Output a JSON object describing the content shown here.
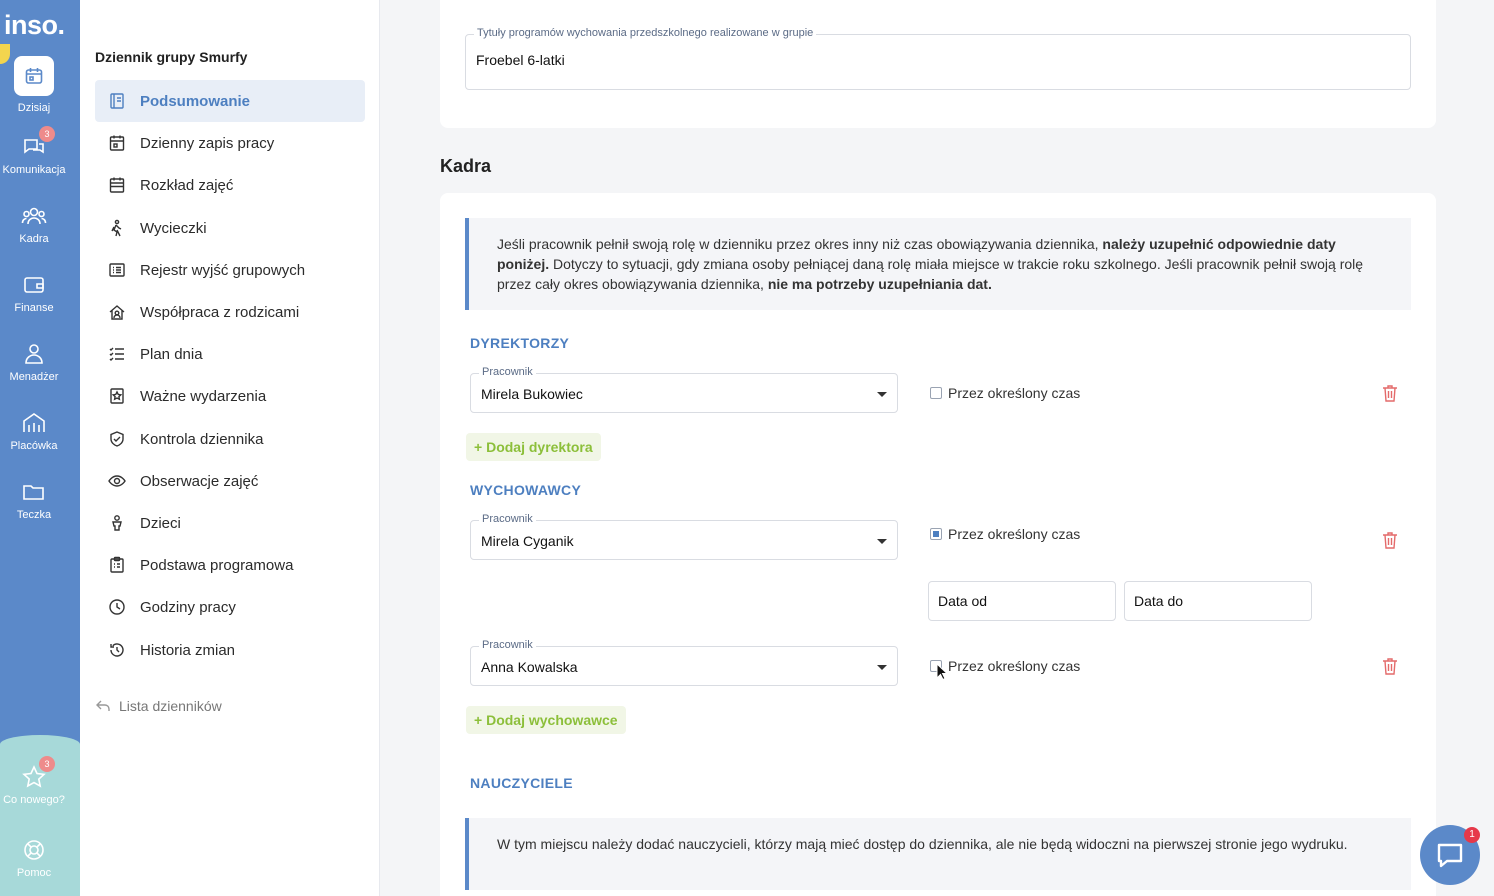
{
  "rail": {
    "logo": "inso.",
    "items": [
      {
        "label": "Dzisiaj",
        "icon": "calendar-icon"
      },
      {
        "label": "Komunikacja",
        "icon": "chat-icon",
        "badge": "3"
      },
      {
        "label": "Kadra",
        "icon": "people-icon"
      },
      {
        "label": "Finanse",
        "icon": "wallet-icon"
      },
      {
        "label": "Menadżer",
        "icon": "manager-icon"
      },
      {
        "label": "Placówka",
        "icon": "building-icon"
      },
      {
        "label": "Teczka",
        "icon": "folder-icon"
      },
      {
        "label": "Co nowego?",
        "icon": "star-icon",
        "badge": "3"
      },
      {
        "label": "Pomoc",
        "icon": "lifebuoy-icon"
      }
    ]
  },
  "sidebar": {
    "title": "Dziennik grupy Smurfy",
    "items": [
      {
        "label": "Podsumowanie",
        "icon": "document-icon"
      },
      {
        "label": "Dzienny zapis pracy",
        "icon": "calendar-day-icon"
      },
      {
        "label": "Rozkład zajęć",
        "icon": "calendar-grid-icon"
      },
      {
        "label": "Wycieczki",
        "icon": "hiker-icon"
      },
      {
        "label": "Rejestr wyjść grupowych",
        "icon": "list-icon"
      },
      {
        "label": "Współpraca z rodzicami",
        "icon": "house-icon"
      },
      {
        "label": "Plan dnia",
        "icon": "checklist-icon"
      },
      {
        "label": "Ważne wydarzenia",
        "icon": "event-icon"
      },
      {
        "label": "Kontrola dziennika",
        "icon": "shield-icon"
      },
      {
        "label": "Obserwacje zajęć",
        "icon": "eye-icon"
      },
      {
        "label": "Dzieci",
        "icon": "child-icon"
      },
      {
        "label": "Podstawa programowa",
        "icon": "clipboard-icon"
      },
      {
        "label": "Godziny pracy",
        "icon": "clock-icon"
      },
      {
        "label": "Historia zmian",
        "icon": "history-icon"
      }
    ],
    "back_label": "Lista dzienników"
  },
  "program": {
    "label": "Tytuły programów wychowania przedszkolnego realizowane w grupie",
    "value": "Froebel 6-latki"
  },
  "kadra": {
    "title": "Kadra",
    "info_1": "Jeśli pracownik pełnił swoją rolę w dzienniku przez okres inny niż czas obowiązywania dziennika,",
    "info_bold_1": "należy uzupełnić odpowiednie daty poniżej.",
    "info_2": "Dotyczy to sytuacji, gdy zmiana osoby pełniącej daną rolę miała miejsce w trakcie roku szkolnego. Jeśli pracownik pełnił swoją rolę przez cały okres obowiązywania dziennika,",
    "info_bold_2": "nie ma potrzeby uzupełniania dat.",
    "field_label": "Pracownik",
    "period_label": "Przez określony czas",
    "directors": {
      "heading": "DYREKTORZY",
      "value": "Mirela Bukowiec",
      "period_checked": false,
      "add_label": "Dodaj dyrektora"
    },
    "teachers_head": {
      "heading": "WYCHOWAWCY",
      "rows": [
        {
          "value": "Mirela Cyganik",
          "period_checked": true
        },
        {
          "value": "Anna Kowalska",
          "period_checked": false
        }
      ],
      "date_from": "Data od",
      "date_to": "Data do",
      "add_label": "Dodaj wychowawce"
    },
    "nauczyciele": {
      "heading": "NAUCZYCIELE",
      "info": "W tym miejscu należy dodać nauczycieli, którzy mają mieć dostęp do dziennika, ale nie będą widoczni na pierwszej stronie jego wydruku."
    }
  },
  "chat_badge": "1",
  "colors": {
    "accent": "#5b89c9",
    "active_text": "#4d7fc0",
    "add_green": "#8cbf3a",
    "trash_red": "#e46a6a"
  }
}
